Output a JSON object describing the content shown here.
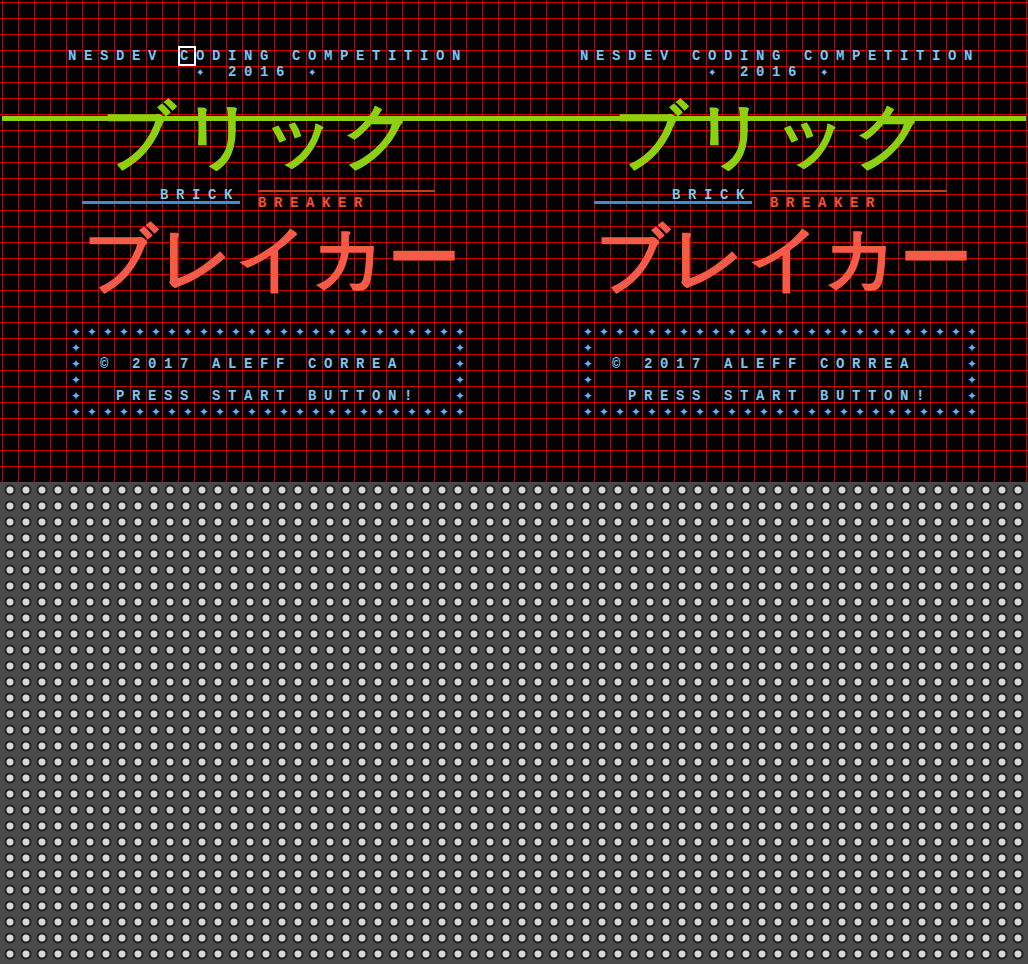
{
  "viewer": {
    "nametables": [
      {
        "title": "NESDEV CODING COMPETITION",
        "year": "✦ 2016 ✦",
        "logo_top": "ブリック",
        "label_left": "BRICK",
        "label_right": "BREAKER",
        "logo_bottom": "ブレイカー",
        "credit": "© 2017 ALEFF CORREA",
        "prompt": "PRESS START BUTTON!",
        "border_glyph": "✦",
        "cursor": true
      },
      {
        "title": "NESDEV CODING COMPETITION",
        "year": "✦ 2016 ✦",
        "logo_top": "ブリック",
        "label_left": "BRICK",
        "label_right": "BREAKER",
        "logo_bottom": "ブレイカー",
        "credit": "© 2017 ALEFF CORREA",
        "prompt": "PRESS START BUTTON!",
        "border_glyph": "✦",
        "cursor": false
      }
    ]
  }
}
